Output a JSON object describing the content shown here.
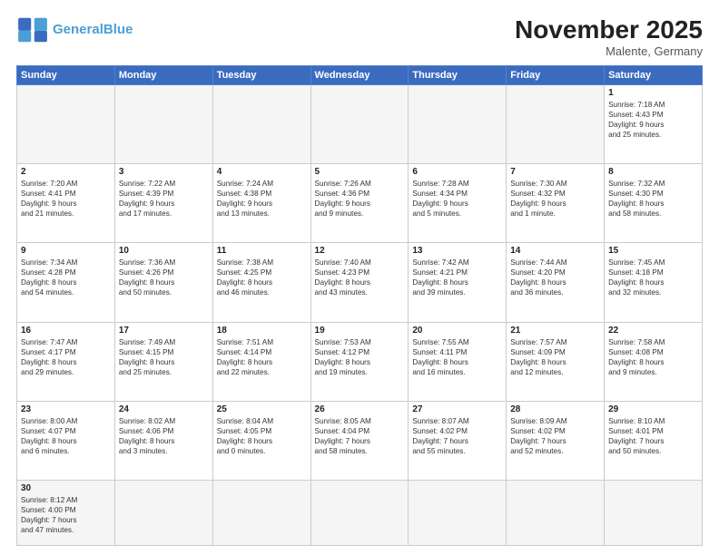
{
  "header": {
    "logo_general": "General",
    "logo_blue": "Blue",
    "month_title": "November 2025",
    "subtitle": "Malente, Germany"
  },
  "days_of_week": [
    "Sunday",
    "Monday",
    "Tuesday",
    "Wednesday",
    "Thursday",
    "Friday",
    "Saturday"
  ],
  "cells": [
    {
      "day": "",
      "empty": true
    },
    {
      "day": "",
      "empty": true
    },
    {
      "day": "",
      "empty": true
    },
    {
      "day": "",
      "empty": true
    },
    {
      "day": "",
      "empty": true
    },
    {
      "day": "",
      "empty": true
    },
    {
      "day": "1",
      "text": "Sunrise: 7:18 AM\nSunset: 4:43 PM\nDaylight: 9 hours\nand 25 minutes."
    },
    {
      "day": "2",
      "text": "Sunrise: 7:20 AM\nSunset: 4:41 PM\nDaylight: 9 hours\nand 21 minutes."
    },
    {
      "day": "3",
      "text": "Sunrise: 7:22 AM\nSunset: 4:39 PM\nDaylight: 9 hours\nand 17 minutes."
    },
    {
      "day": "4",
      "text": "Sunrise: 7:24 AM\nSunset: 4:38 PM\nDaylight: 9 hours\nand 13 minutes."
    },
    {
      "day": "5",
      "text": "Sunrise: 7:26 AM\nSunset: 4:36 PM\nDaylight: 9 hours\nand 9 minutes."
    },
    {
      "day": "6",
      "text": "Sunrise: 7:28 AM\nSunset: 4:34 PM\nDaylight: 9 hours\nand 5 minutes."
    },
    {
      "day": "7",
      "text": "Sunrise: 7:30 AM\nSunset: 4:32 PM\nDaylight: 9 hours\nand 1 minute."
    },
    {
      "day": "8",
      "text": "Sunrise: 7:32 AM\nSunset: 4:30 PM\nDaylight: 8 hours\nand 58 minutes."
    },
    {
      "day": "9",
      "text": "Sunrise: 7:34 AM\nSunset: 4:28 PM\nDaylight: 8 hours\nand 54 minutes."
    },
    {
      "day": "10",
      "text": "Sunrise: 7:36 AM\nSunset: 4:26 PM\nDaylight: 8 hours\nand 50 minutes."
    },
    {
      "day": "11",
      "text": "Sunrise: 7:38 AM\nSunset: 4:25 PM\nDaylight: 8 hours\nand 46 minutes."
    },
    {
      "day": "12",
      "text": "Sunrise: 7:40 AM\nSunset: 4:23 PM\nDaylight: 8 hours\nand 43 minutes."
    },
    {
      "day": "13",
      "text": "Sunrise: 7:42 AM\nSunset: 4:21 PM\nDaylight: 8 hours\nand 39 minutes."
    },
    {
      "day": "14",
      "text": "Sunrise: 7:44 AM\nSunset: 4:20 PM\nDaylight: 8 hours\nand 36 minutes."
    },
    {
      "day": "15",
      "text": "Sunrise: 7:45 AM\nSunset: 4:18 PM\nDaylight: 8 hours\nand 32 minutes."
    },
    {
      "day": "16",
      "text": "Sunrise: 7:47 AM\nSunset: 4:17 PM\nDaylight: 8 hours\nand 29 minutes."
    },
    {
      "day": "17",
      "text": "Sunrise: 7:49 AM\nSunset: 4:15 PM\nDaylight: 8 hours\nand 25 minutes."
    },
    {
      "day": "18",
      "text": "Sunrise: 7:51 AM\nSunset: 4:14 PM\nDaylight: 8 hours\nand 22 minutes."
    },
    {
      "day": "19",
      "text": "Sunrise: 7:53 AM\nSunset: 4:12 PM\nDaylight: 8 hours\nand 19 minutes."
    },
    {
      "day": "20",
      "text": "Sunrise: 7:55 AM\nSunset: 4:11 PM\nDaylight: 8 hours\nand 16 minutes."
    },
    {
      "day": "21",
      "text": "Sunrise: 7:57 AM\nSunset: 4:09 PM\nDaylight: 8 hours\nand 12 minutes."
    },
    {
      "day": "22",
      "text": "Sunrise: 7:58 AM\nSunset: 4:08 PM\nDaylight: 8 hours\nand 9 minutes."
    },
    {
      "day": "23",
      "text": "Sunrise: 8:00 AM\nSunset: 4:07 PM\nDaylight: 8 hours\nand 6 minutes."
    },
    {
      "day": "24",
      "text": "Sunrise: 8:02 AM\nSunset: 4:06 PM\nDaylight: 8 hours\nand 3 minutes."
    },
    {
      "day": "25",
      "text": "Sunrise: 8:04 AM\nSunset: 4:05 PM\nDaylight: 8 hours\nand 0 minutes."
    },
    {
      "day": "26",
      "text": "Sunrise: 8:05 AM\nSunset: 4:04 PM\nDaylight: 7 hours\nand 58 minutes."
    },
    {
      "day": "27",
      "text": "Sunrise: 8:07 AM\nSunset: 4:02 PM\nDaylight: 7 hours\nand 55 minutes."
    },
    {
      "day": "28",
      "text": "Sunrise: 8:09 AM\nSunset: 4:02 PM\nDaylight: 7 hours\nand 52 minutes."
    },
    {
      "day": "29",
      "text": "Sunrise: 8:10 AM\nSunset: 4:01 PM\nDaylight: 7 hours\nand 50 minutes."
    },
    {
      "day": "30",
      "text": "Sunrise: 8:12 AM\nSunset: 4:00 PM\nDaylight: 7 hours\nand 47 minutes."
    },
    {
      "day": "",
      "empty": true
    },
    {
      "day": "",
      "empty": true
    },
    {
      "day": "",
      "empty": true
    },
    {
      "day": "",
      "empty": true
    },
    {
      "day": "",
      "empty": true
    },
    {
      "day": "",
      "empty": true
    }
  ]
}
